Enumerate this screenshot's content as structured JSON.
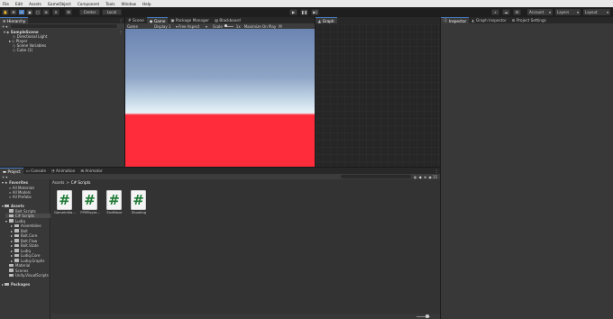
{
  "menu": [
    "File",
    "Edit",
    "Assets",
    "GameObject",
    "Component",
    "Tools",
    "Window",
    "Help"
  ],
  "toolbar": {
    "center_label": "Center",
    "local_label": "Local",
    "account_label": "Account",
    "layers_label": "Layers",
    "layout_label": "Layout"
  },
  "hierarchy": {
    "tab": "Hierarchy",
    "add_label": "+",
    "scene": "SampleScene",
    "items": [
      "Directional Light",
      "Player",
      "Scene Variables",
      "Cube (1)"
    ]
  },
  "scene_tabs": [
    "Scene",
    "Game",
    "Package Manager",
    "Blackboard"
  ],
  "graph_tab": "Graph",
  "game_toolbar": {
    "display_mode": "Game",
    "display": "Display 1",
    "aspect": "Free Aspect",
    "scale_label": "Scale",
    "scale_value": "1x",
    "maximize": "Maximize On Play",
    "mute": "M"
  },
  "game_view": {
    "sky_top": "#6b85b3",
    "horizon": "#e9f3f9",
    "ground": "#ff2c3c"
  },
  "right_tabs": [
    "Inspector",
    "Graph Inspector",
    "Project Settings"
  ],
  "bottom_tabs": [
    "Project",
    "Console",
    "Animation",
    "Animator"
  ],
  "project": {
    "add_label": "+",
    "favorites_label": "Favorites",
    "favorites": [
      "All Materials",
      "All Models",
      "All Prefabs"
    ],
    "assets_label": "Assets",
    "assets_tree": [
      {
        "label": "Bolt Scripts",
        "depth": 1
      },
      {
        "label": "C# Scripts",
        "depth": 1
      },
      {
        "label": "Ludiq",
        "depth": 1
      },
      {
        "label": "Assemblies",
        "depth": 2
      },
      {
        "label": "Bolt",
        "depth": 2
      },
      {
        "label": "Bolt.Core",
        "depth": 2
      },
      {
        "label": "Bolt.Flow",
        "depth": 2
      },
      {
        "label": "Bolt.State",
        "depth": 2
      },
      {
        "label": "Ludiq",
        "depth": 2
      },
      {
        "label": "Ludiq.Core",
        "depth": 2
      },
      {
        "label": "Ludiq.Graphs",
        "depth": 2
      },
      {
        "label": "Material",
        "depth": 1
      },
      {
        "label": "Scenes",
        "depth": 1
      },
      {
        "label": "Unity.VisualScripts",
        "depth": 1
      }
    ],
    "packages_label": "Packages",
    "breadcrumb": [
      "Assets",
      "C# Scripts"
    ],
    "breadcrumb_sep": ">",
    "scripts": [
      "GameInitia...",
      "FPSPlayer...",
      "EndMove",
      "Shooting"
    ],
    "script_glyph": "#",
    "count": "15"
  }
}
